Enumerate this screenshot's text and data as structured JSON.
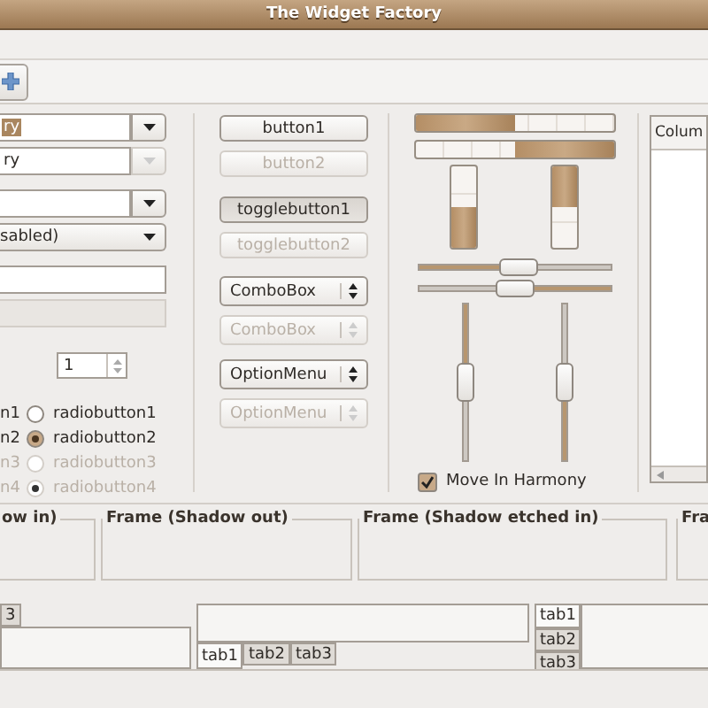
{
  "window": {
    "title": "The Widget Factory"
  },
  "left_groups": [
    [
      {
        "kind": "combo-entry",
        "value": "ry",
        "text_highlighted": true,
        "disabled": false
      },
      {
        "kind": "combo-entry",
        "value": "ry",
        "text_highlighted": false,
        "disabled": true
      }
    ],
    [
      {
        "kind": "combo-entry",
        "disabled": false
      },
      {
        "kind": "combo-box",
        "value": "sabled)",
        "disabled": false
      }
    ],
    [
      {
        "kind": "entry",
        "disabled": false
      },
      {
        "kind": "entry",
        "disabled": true
      }
    ]
  ],
  "spin": {
    "value": "1"
  },
  "radio_rows": [
    {
      "check_label": "n1",
      "radio_label": "radiobutton1",
      "selected": false,
      "disabled": false
    },
    {
      "check_label": "n2",
      "radio_label": "radiobutton2",
      "selected": true,
      "disabled": false
    },
    {
      "check_label": "n3",
      "radio_label": "radiobutton3",
      "selected": false,
      "disabled": true
    },
    {
      "check_label": "n4",
      "radio_label": "radiobutton4",
      "selected": true,
      "disabled": true
    }
  ],
  "button_groups": [
    [
      {
        "kind": "button",
        "label": "button1",
        "disabled": false
      },
      {
        "kind": "button",
        "label": "button2",
        "disabled": true
      }
    ],
    [
      {
        "kind": "toggle",
        "label": "togglebutton1",
        "pressed": true,
        "disabled": false
      },
      {
        "kind": "toggle",
        "label": "togglebutton2",
        "pressed": false,
        "disabled": true
      }
    ],
    [
      {
        "kind": "combo",
        "label": "ComboBox",
        "disabled": false
      },
      {
        "kind": "combo",
        "label": "ComboBox",
        "disabled": true
      }
    ],
    [
      {
        "kind": "combo",
        "label": "OptionMenu",
        "disabled": false
      },
      {
        "kind": "combo",
        "label": "OptionMenu",
        "disabled": true
      }
    ]
  ],
  "hprogress": [
    {
      "level": 0.5,
      "inverted": false
    },
    {
      "level": 0.5,
      "inverted": true
    }
  ],
  "vprogress": [
    {
      "level": 0.5,
      "inverted": false
    },
    {
      "level": 0.5,
      "inverted": true
    }
  ],
  "hscales": [
    {
      "level": 0.52,
      "inverted": false
    },
    {
      "level": 0.5,
      "inverted": true
    }
  ],
  "vscales": [
    {
      "level": 0.5,
      "inverted": false
    },
    {
      "level": 0.5,
      "inverted": true
    }
  ],
  "harmony": {
    "label": "Move In Harmony",
    "checked": true
  },
  "tree": {
    "column": "Colum"
  },
  "frames": [
    {
      "label": "ow in)"
    },
    {
      "label": "Frame (Shadow out)"
    },
    {
      "label": "Frame (Shadow etched in)"
    },
    {
      "label": "Fra"
    }
  ],
  "notebooks": [
    {
      "kind": "top",
      "tabs": [
        {
          "label": "3",
          "selected": false
        }
      ]
    },
    {
      "kind": "bottom",
      "tabs": [
        {
          "label": "tab1",
          "selected": true
        },
        {
          "label": "tab2",
          "selected": false
        },
        {
          "label": "tab3",
          "selected": false
        }
      ]
    },
    {
      "kind": "left",
      "tabs": [
        {
          "label": "tab1",
          "selected": true
        },
        {
          "label": "tab2",
          "selected": false
        },
        {
          "label": "tab3",
          "selected": false
        }
      ]
    }
  ]
}
